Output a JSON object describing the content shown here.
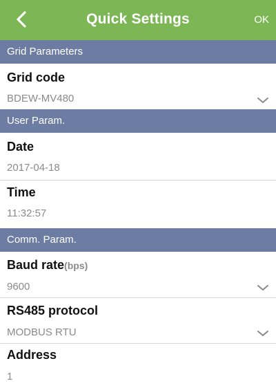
{
  "header": {
    "title": "Quick Settings",
    "ok_label": "OK",
    "back_icon": "chevron-left-icon"
  },
  "sections": {
    "grid": {
      "title": "Grid Parameters",
      "grid_code": {
        "label": "Grid code",
        "value": "BDEW-MV480"
      }
    },
    "user": {
      "title": "User Param.",
      "date": {
        "label": "Date",
        "value": "2017-04-18"
      },
      "time": {
        "label": "Time",
        "value": "11:32:57"
      }
    },
    "comm": {
      "title": "Comm. Param.",
      "baud_rate": {
        "label": "Baud rate",
        "unit": "(bps)",
        "value": "9600"
      },
      "rs485": {
        "label": "RS485 protocol",
        "value": "MODBUS RTU"
      },
      "address": {
        "label": "Address",
        "value": "1"
      }
    }
  },
  "colors": {
    "header_bg": "#7cb655",
    "section_bg": "#6d7ca3",
    "value_text": "#8a8a8a"
  }
}
